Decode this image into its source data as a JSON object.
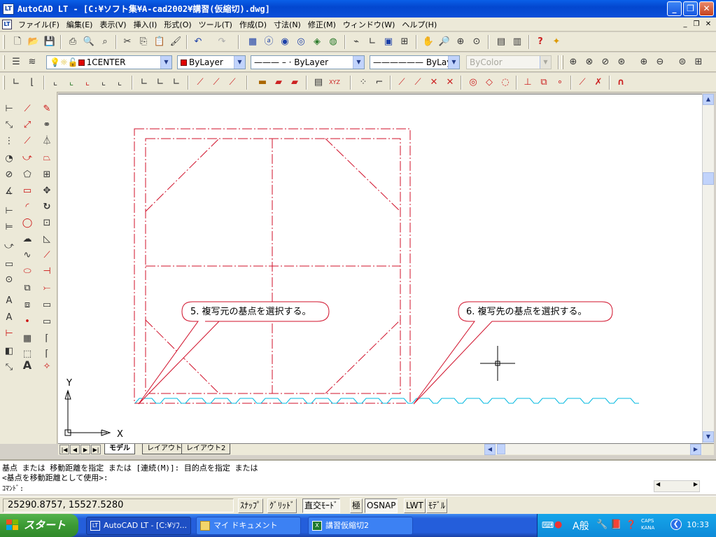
{
  "title": "AutoCAD LT - [C:¥ソフト集¥A-cad2002¥講習(仮縮切).dwg]",
  "menu": [
    "ファイル(F)",
    "編集(E)",
    "表示(V)",
    "挿入(I)",
    "形式(O)",
    "ツール(T)",
    "作成(D)",
    "寸法(N)",
    "修正(M)",
    "ウィンドウ(W)",
    "ヘルプ(H)"
  ],
  "layers": {
    "layer_name": "1CENTER",
    "color": "ByLayer",
    "linetype_label": "ByLayer",
    "lineweight_label": "ByLayer",
    "plotstyle": "ByColor"
  },
  "drawing": {
    "callout_5": "5. 複写元の基点を選択する。",
    "callout_6": "6. 複写先の基点を選択する。",
    "ucs_x": "X",
    "ucs_y": "Y",
    "colors": {
      "dashdot": "#d0102a",
      "wave": "#00b8e0",
      "callout": "#d0102a"
    }
  },
  "tabs": [
    "モデル",
    "レイアウト1",
    "レイアウト2"
  ],
  "command": {
    "line1": "基点 または 移動距離を指定 または [連続(M)]: 目的点を指定 または",
    "line2": "<基点を移動距離として使用>:",
    "prompt": "ｺﾏﾝﾄﾞ:"
  },
  "status": {
    "coords": "25290.8757, 15527.5280",
    "snap": "ｽﾅｯﾌﾟ",
    "grid": "ｸﾞﾘｯﾄﾞ",
    "ortho": "直交ﾓｰﾄﾞ",
    "polar": "極",
    "osnap": "OSNAP",
    "lwt": "LWT",
    "model": "ﾓﾃﾞﾙ"
  },
  "taskbar": {
    "start": "スタート",
    "task1": "AutoCAD LT - [C:¥ｿﾌ...",
    "task2": "マイ ドキュメント",
    "task3": "講習仮縮切2",
    "ime_mode": "A般",
    "caps": "CAPS",
    "kana": "KANA",
    "clock": "10:33"
  }
}
